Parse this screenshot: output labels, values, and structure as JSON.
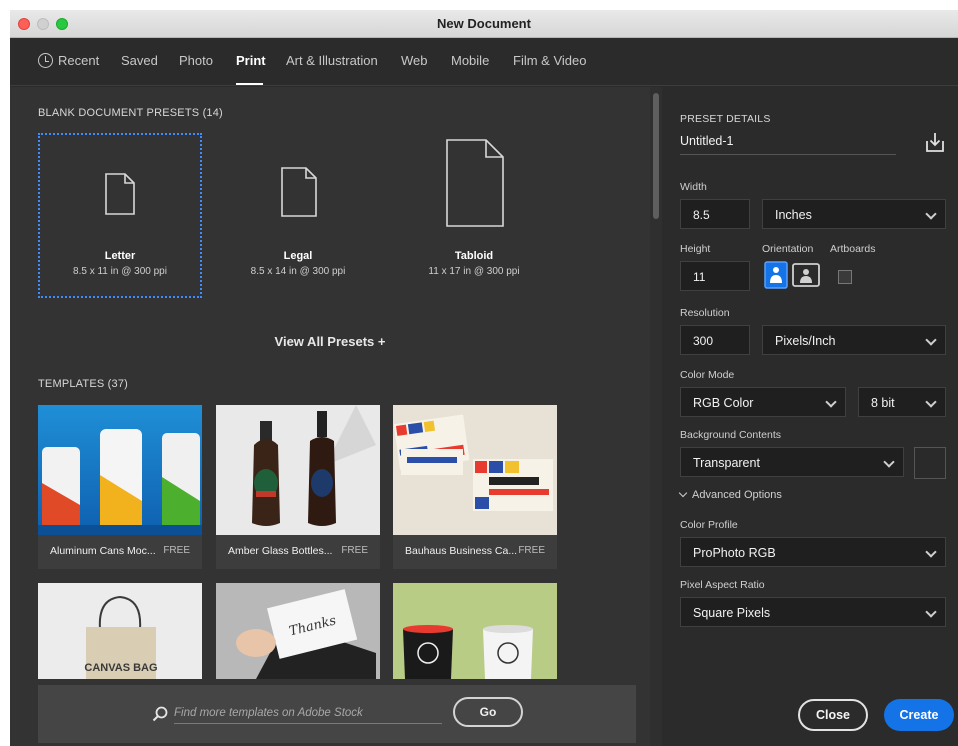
{
  "window": {
    "title": "New Document"
  },
  "tabs": [
    {
      "label": "Recent",
      "icon": "clock-icon"
    },
    {
      "label": "Saved"
    },
    {
      "label": "Photo"
    },
    {
      "label": "Print",
      "active": true
    },
    {
      "label": "Art & Illustration"
    },
    {
      "label": "Web"
    },
    {
      "label": "Mobile"
    },
    {
      "label": "Film & Video"
    }
  ],
  "presets": {
    "heading": "BLANK DOCUMENT PRESETS",
    "count": "(14)",
    "items": [
      {
        "name": "Letter",
        "size": "8.5 x 11 in @ 300 ppi",
        "selected": true
      },
      {
        "name": "Legal",
        "size": "8.5 x 14 in @ 300 ppi"
      },
      {
        "name": "Tabloid",
        "size": "11 x 17 in @ 300 ppi"
      }
    ],
    "view_all": "View All Presets +"
  },
  "templates": {
    "heading": "TEMPLATES",
    "count": "(37)",
    "items": [
      {
        "title": "Aluminum Cans Moc...",
        "badge": "FREE"
      },
      {
        "title": "Amber Glass Bottles...",
        "badge": "FREE"
      },
      {
        "title": "Bauhaus Business Ca...",
        "badge": "FREE"
      },
      {
        "thumb_text": "CANVAS BAG"
      },
      {
        "thumb_text": "Thanks"
      },
      {
        "thumb_text": ""
      }
    ]
  },
  "search": {
    "placeholder": "Find more templates on Adobe Stock",
    "go_label": "Go"
  },
  "details": {
    "heading": "PRESET DETAILS",
    "name": "Untitled-1",
    "width_label": "Width",
    "width_value": "8.5",
    "width_unit": "Inches",
    "height_label": "Height",
    "height_value": "11",
    "orientation_label": "Orientation",
    "orientation": "portrait",
    "artboards_label": "Artboards",
    "artboards_checked": false,
    "resolution_label": "Resolution",
    "resolution_value": "300",
    "resolution_unit": "Pixels/Inch",
    "color_mode_label": "Color Mode",
    "color_mode": "RGB Color",
    "bit_depth": "8 bit",
    "background_label": "Background Contents",
    "background": "Transparent",
    "advanced_label": "Advanced Options",
    "color_profile_label": "Color Profile",
    "color_profile": "ProPhoto RGB",
    "pixel_aspect_label": "Pixel Aspect Ratio",
    "pixel_aspect": "Square Pixels"
  },
  "actions": {
    "close": "Close",
    "create": "Create"
  },
  "colors": {
    "accent": "#1473e6",
    "selection": "#3b8cff",
    "panel": "#333333",
    "sidebar": "#2b2b2b"
  }
}
